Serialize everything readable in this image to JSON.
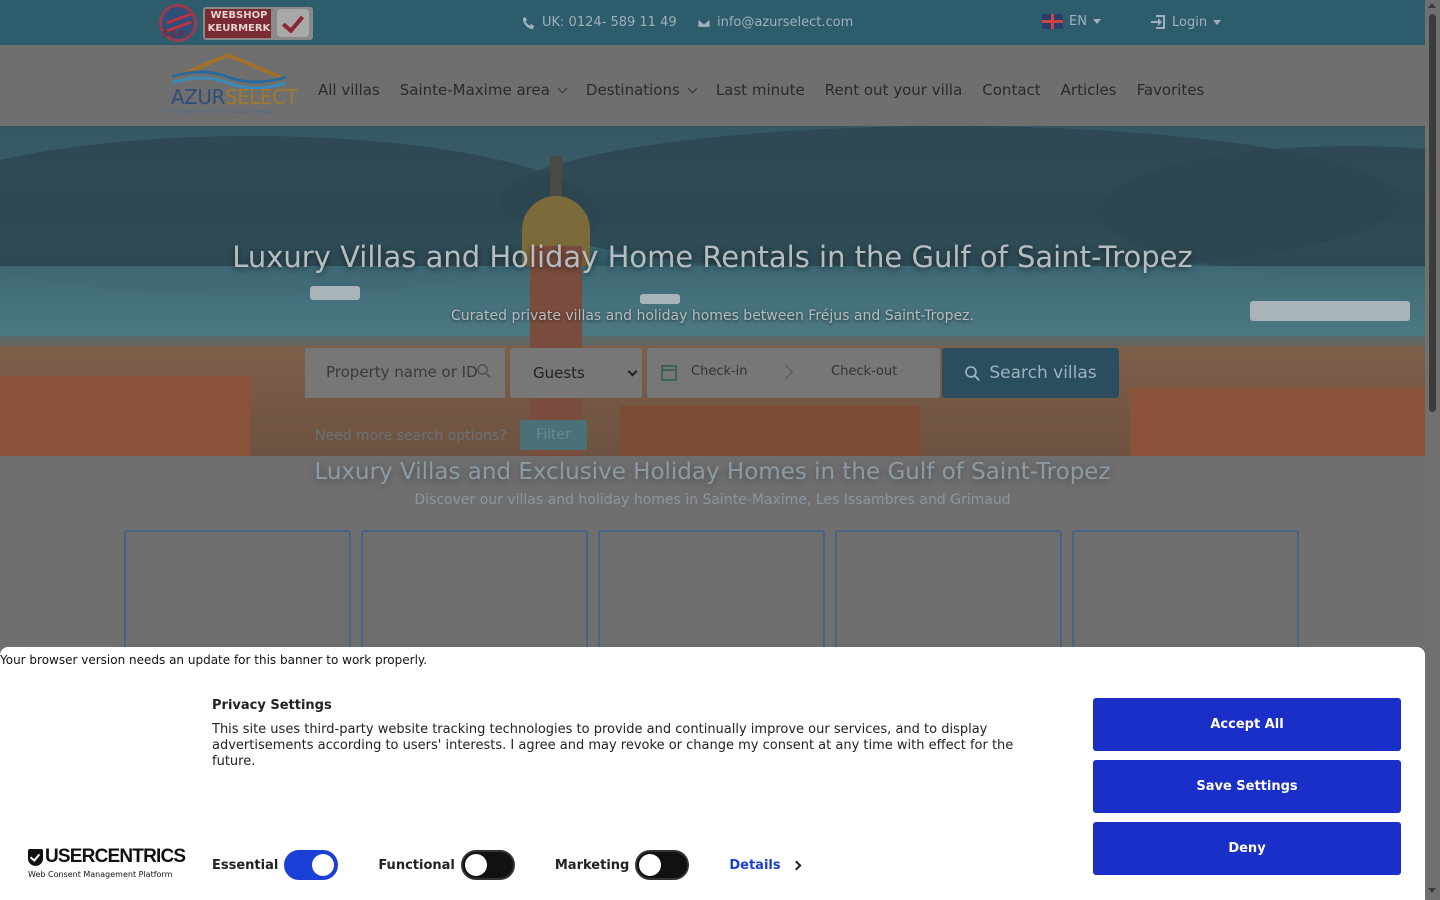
{
  "topbar": {
    "badge_text": "SGR",
    "webshop_line1": "WEBSHOP",
    "webshop_line2": "KEURMERK",
    "phone": "UK: 0124- 589 11 49",
    "email": "info@azurselect.com",
    "language": "EN",
    "login": "Login"
  },
  "logo": {
    "part1": "AZUR",
    "part2": "SELECT",
    "tagline": "For the perfect French vacation rentals"
  },
  "nav": {
    "items": [
      {
        "label": "All villas",
        "dropdown": false
      },
      {
        "label": "Sainte-Maxime area",
        "dropdown": true
      },
      {
        "label": "Destinations",
        "dropdown": true
      },
      {
        "label": "Last minute",
        "dropdown": false
      },
      {
        "label": "Rent out your villa",
        "dropdown": false
      },
      {
        "label": "Contact",
        "dropdown": false
      },
      {
        "label": "Articles",
        "dropdown": false
      },
      {
        "label": "Favorites",
        "dropdown": false
      }
    ]
  },
  "hero": {
    "title": "Luxury Villas and Holiday Home Rentals in the Gulf of Saint-Tropez",
    "subtitle": "Curated private villas and holiday homes between Fréjus and Saint-Tropez."
  },
  "search": {
    "name_placeholder": "Property name or ID",
    "guests_value": "Guests",
    "checkin": "Check-in",
    "checkout": "Check-out",
    "button": "Search villas",
    "more_options": "Need more search options?",
    "filter": "Filter"
  },
  "section": {
    "title": "Luxury Villas and Exclusive Holiday Homes in the Gulf of Saint-Tropez",
    "subtitle": "Discover our villas and holiday homes in Sainte-Maxime, Les Issambres and Grimaud"
  },
  "consent": {
    "browser_note": "Your browser version needs an update for this banner to work properly.",
    "title": "Privacy Settings",
    "text": "This site uses third-party website tracking technologies to provide and continually improve our services, and to display advertisements according to users' interests. I agree and may revoke or change my consent at any time with effect for the future.",
    "logo_main": "USERCENTRICS",
    "logo_sub": "Web Consent Management Platform",
    "toggles": [
      {
        "label": "Essential",
        "on": true
      },
      {
        "label": "Functional",
        "on": false
      },
      {
        "label": "Marketing",
        "on": false
      }
    ],
    "details": "Details",
    "accept_all": "Accept All",
    "save_settings": "Save Settings",
    "deny": "Deny",
    "accent_color": "#1a2fc7"
  }
}
